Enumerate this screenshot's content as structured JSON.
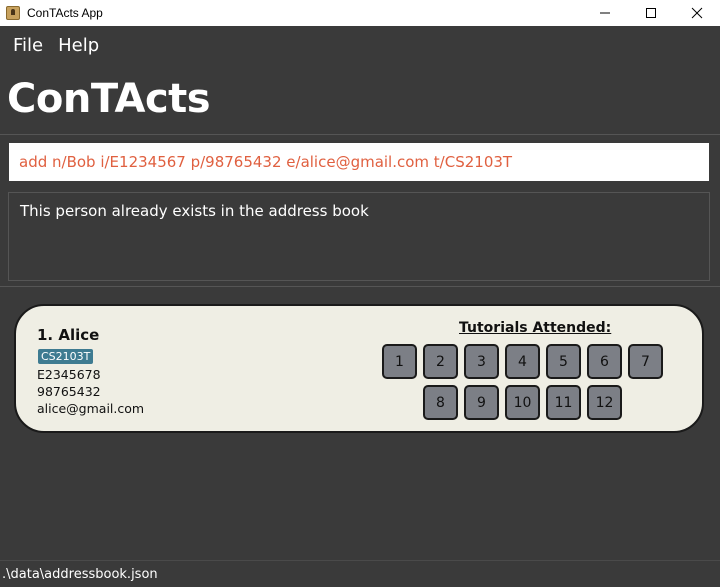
{
  "window": {
    "title": "ConTActs App",
    "minimize_icon": "minimize-icon",
    "maximize_icon": "maximize-icon",
    "close_icon": "close-icon"
  },
  "menu": [
    "File",
    "Help"
  ],
  "app_heading": "ConTActs",
  "command": {
    "value": "add n/Bob i/E1234567 p/98765432 e/alice@gmail.com t/CS2103T",
    "color": "#e06040"
  },
  "result": "This person already exists in the address book",
  "persons": [
    {
      "index_name": "1. Alice",
      "tag": "CS2103T",
      "student_id": "E2345678",
      "phone": "98765432",
      "email": "alice@gmail.com",
      "tutorials_heading": "Tutorials Attended:",
      "tutorials": [
        "1",
        "2",
        "3",
        "4",
        "5",
        "6",
        "7",
        "8",
        "9",
        "10",
        "11",
        "12"
      ]
    }
  ],
  "status_path": ".\\data\\addressbook.json",
  "colors": {
    "background": "#3a3a3a",
    "card": "#efeee4",
    "tag": "#3e7b91",
    "tutorial_box": "#7c7f86"
  }
}
